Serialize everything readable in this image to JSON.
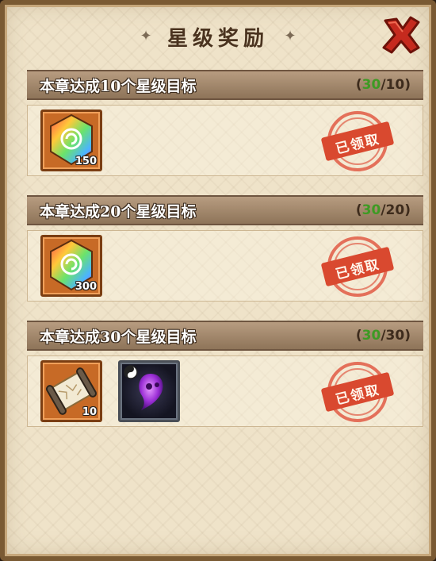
{
  "dialog": {
    "title": "星级奖励",
    "close_icon": "close-x-icon"
  },
  "colors": {
    "header_bg": "#a58a6e",
    "progress_current": "#3e9a24",
    "stamp_red": "#d9492f",
    "panel_bg": "#efe3c9"
  },
  "sections": [
    {
      "title": "本章达成10个星级目标",
      "progress": {
        "open": "(",
        "current": "30",
        "sep": "/",
        "target": "10",
        "close": ")"
      },
      "rewards": [
        {
          "icon": "rainbow-gem-icon",
          "count": "150"
        }
      ],
      "status": "已领取"
    },
    {
      "title": "本章达成20个星级目标",
      "progress": {
        "open": "(",
        "current": "30",
        "sep": "/",
        "target": "20",
        "close": ")"
      },
      "rewards": [
        {
          "icon": "rainbow-gem-icon",
          "count": "300"
        }
      ],
      "status": "已领取"
    },
    {
      "title": "本章达成30个星级目标",
      "progress": {
        "open": "(",
        "current": "30",
        "sep": "/",
        "target": "30",
        "close": ")"
      },
      "rewards": [
        {
          "icon": "scroll-icon",
          "count": "10"
        },
        {
          "icon": "purple-spirit-icon",
          "count": ""
        }
      ],
      "status": "已领取"
    }
  ]
}
